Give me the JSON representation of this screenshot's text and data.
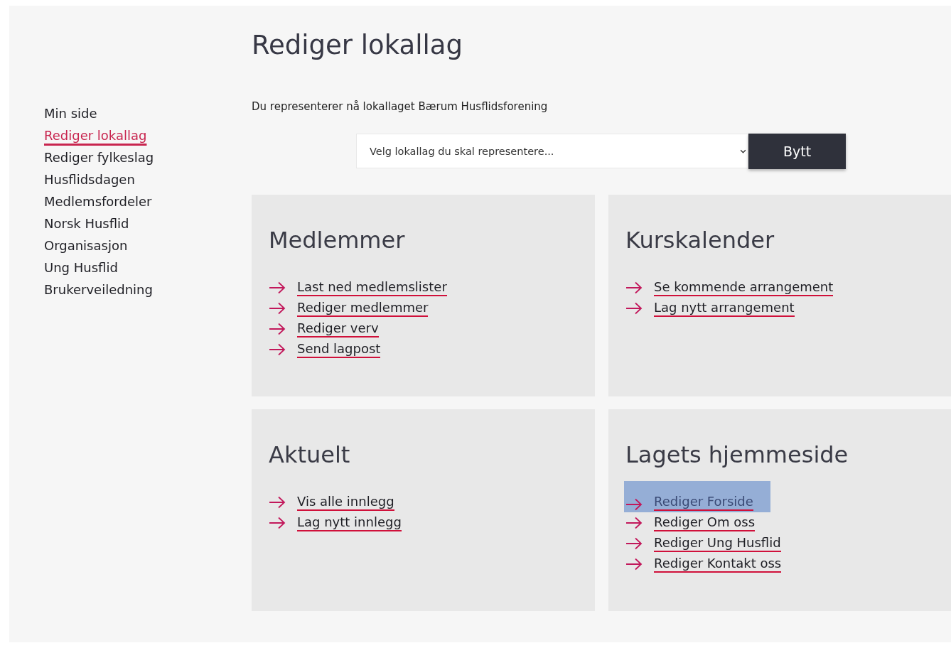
{
  "sidebar": {
    "items": [
      {
        "label": "Min side",
        "selected": false
      },
      {
        "label": "Rediger lokallag",
        "selected": true
      },
      {
        "label": "Rediger fylkeslag",
        "selected": false
      },
      {
        "label": "Husflidsdagen",
        "selected": false
      },
      {
        "label": "Medlemsfordeler",
        "selected": false
      },
      {
        "label": "Norsk Husflid",
        "selected": false
      },
      {
        "label": "Organisasjon",
        "selected": false
      },
      {
        "label": "Ung Husflid",
        "selected": false
      },
      {
        "label": "Brukerveiledning",
        "selected": false
      }
    ]
  },
  "page_title": "Rediger lokallag",
  "intro": "Du representerer nå lokallaget Bærum Husflidsforening",
  "chooser": {
    "placeholder": "Velg lokallag du skal representere...",
    "button": "Bytt"
  },
  "cards": [
    {
      "title": "Medlemmer",
      "links": [
        {
          "label": "Last ned medlemslister",
          "selected": false
        },
        {
          "label": "Rediger medlemmer",
          "selected": false
        },
        {
          "label": "Rediger verv",
          "selected": false
        },
        {
          "label": "Send lagpost",
          "selected": false
        }
      ]
    },
    {
      "title": "Kurskalender",
      "links": [
        {
          "label": "Se kommende arrangement",
          "selected": false
        },
        {
          "label": "Lag nytt arrangement",
          "selected": false
        }
      ]
    },
    {
      "title": "Aktuelt",
      "links": [
        {
          "label": "Vis alle innlegg",
          "selected": false
        },
        {
          "label": "Lag nytt innlegg",
          "selected": false
        }
      ]
    },
    {
      "title": "Lagets hjemmeside",
      "links": [
        {
          "label": "Rediger Forside",
          "selected": true
        },
        {
          "label": "Rediger Om oss",
          "selected": false
        },
        {
          "label": "Rediger Ung Husflid",
          "selected": false
        },
        {
          "label": "Rediger Kontakt oss",
          "selected": false
        }
      ]
    }
  ]
}
